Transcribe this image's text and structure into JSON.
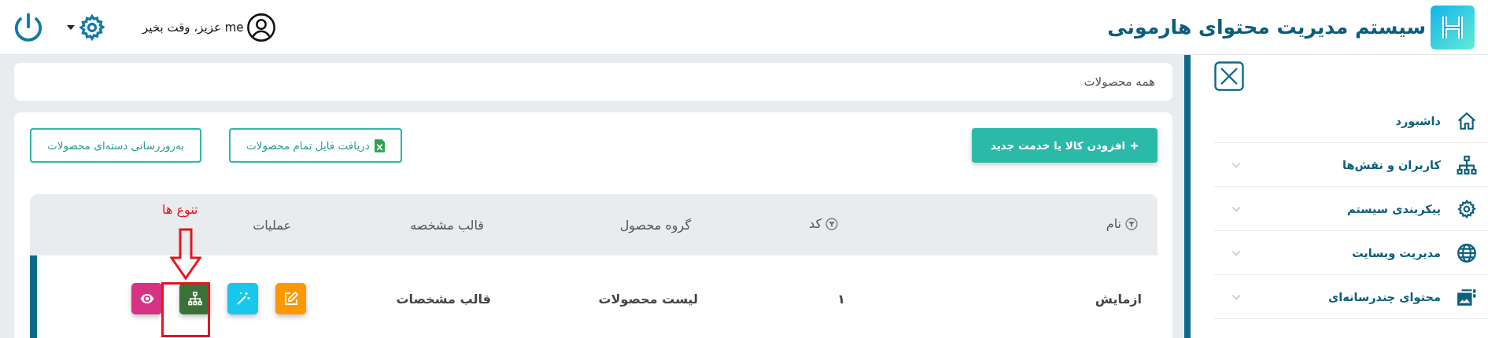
{
  "header": {
    "title": "سیستم مدیریت محتوای هارمونی",
    "greeting": "me عزیز، وقت بخیر"
  },
  "sidebar": {
    "items": [
      {
        "label": "داشبورد",
        "has_submenu": false
      },
      {
        "label": "کاربران و نقش‌ها",
        "has_submenu": true
      },
      {
        "label": "پیکربندی سیستم",
        "has_submenu": true
      },
      {
        "label": "مدیریت وبسایت",
        "has_submenu": true
      },
      {
        "label": "محتوای چندرسانه‌ای",
        "has_submenu": true
      }
    ]
  },
  "breadcrumb": "همه محصولات",
  "toolbar": {
    "add_button": "افزودن کالا یا خدمت جدید",
    "download_button": "دریافت فایل تمام محصولات",
    "bulk_update_button": "به‌روزرسانی دسته‌ای محصولات"
  },
  "table": {
    "columns": [
      {
        "label": "نام",
        "filterable": true
      },
      {
        "label": "کد",
        "filterable": true
      },
      {
        "label": "گروه محصول",
        "filterable": false
      },
      {
        "label": "قالب مشخصه",
        "filterable": false
      },
      {
        "label": "عملیات",
        "filterable": false
      }
    ],
    "rows": [
      {
        "cells": [
          "ازمایش",
          "۱",
          "لیست محصولات",
          "قالب مشخصات"
        ],
        "actions": [
          {
            "color": "#ff9800"
          },
          {
            "color": "#17c7ee"
          },
          {
            "color": "#3b7039"
          },
          {
            "color": "#d63384"
          }
        ]
      }
    ]
  },
  "annotation": {
    "text": "تنوع ها"
  }
}
